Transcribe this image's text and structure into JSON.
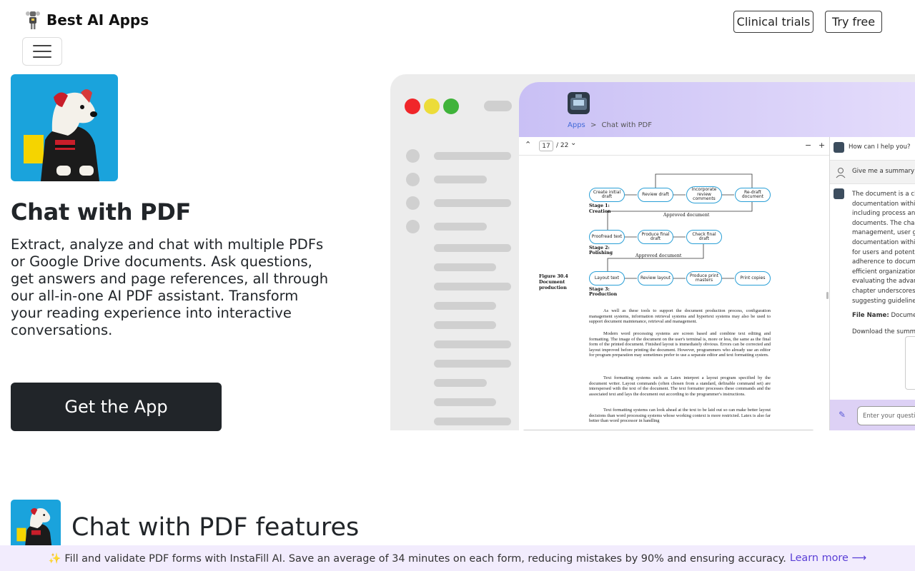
{
  "header": {
    "brand": "Best AI Apps",
    "clinical_trials": "Clinical trials",
    "try_free": "Try free"
  },
  "hero": {
    "title": "Chat with PDF",
    "description": "Extract, analyze and chat with multiple PDFs or Google Drive documents. Ask questions, get answers and page references, all through our all-in-one AI PDF assistant. Transform your reading experience into interactive conversations.",
    "cta": "Get the App"
  },
  "mockup": {
    "breadcrumb": {
      "apps": "Apps",
      "sep": ">",
      "current": "Chat with PDF"
    },
    "pdf": {
      "page": "17",
      "total": "/ 22",
      "minus": "−",
      "plus": "+"
    },
    "figure": {
      "caption": [
        "Figure 30.4",
        "Document",
        "production"
      ],
      "stage1": [
        "Stage 1:",
        "Creation"
      ],
      "stage2": [
        "Stage 2:",
        "Polishing"
      ],
      "stage3": [
        "Stage 3:",
        "Production"
      ],
      "approved1": "Approved document",
      "approved2": "Approved document",
      "nodes": {
        "n1": "Create initial draft",
        "n2": "Review draft",
        "n3": "Incorporate review comments",
        "n4": "Re-draft document",
        "n5": "Proofread text",
        "n6": "Produce final draft",
        "n7": "Check final draft",
        "n8": "Layout text",
        "n9": "Review layout",
        "n10": "Produce print masters",
        "n11": "Print copies"
      }
    },
    "paragraphs": [
      "As well as these tools to support the document production process, configuration management systems, information retrieval systems and hypertext systems may also be used to support document maintenance, retrieval and management.",
      "Modern word processing systems are screen based and combine text editing and formatting. The image of the document on the user's terminal is, more or less, the same as the final form of the printed document. Finished layout is immediately obvious. Errors can be corrected and layout improved before printing the document. However, programmers who already use an editor for program preparation may sometimes prefer to use a separate editor and text formatting system.",
      "Text formatting systems such as Latex interpret a layout program specified by the document writer. Layout commands (often chosen from a standard, definable command set) are interspersed with the text of the document. The text formatter processes these commands and the associated text and lays the document out according to the programmer's instructions.",
      "Text formatting systems can look ahead at the text to be laid out so can make better layout decisions than word processing systems whose working context is more restricted. Latex is also far better than word processor in handling"
    ],
    "chat": {
      "greeting": "How can I help you?",
      "user_msg": "Give me a summary o",
      "answer_lines": [
        "The document is a cha",
        "documentation within",
        "including process and",
        "documents. The chapt",
        "management, user gu",
        "documentation within",
        "for users and potentia",
        "adherence to docume",
        "efficient organization",
        "evaluating the advanta",
        "chapter underscores t",
        "suggesting guidelines"
      ],
      "file_name_label": "File Name:",
      "file_name_value": "Documen",
      "download": "Download the summa",
      "input_placeholder": "Enter your question"
    }
  },
  "features": {
    "title": "Chat with PDF features"
  },
  "banner": {
    "text": "✨ Fill and validate PDF forms with InstaFill AI. Save an average of 34 minutes on each form, reducing mistakes by 90% and ensuring accuracy.",
    "link": "Learn more",
    "arrow": "⟶"
  }
}
